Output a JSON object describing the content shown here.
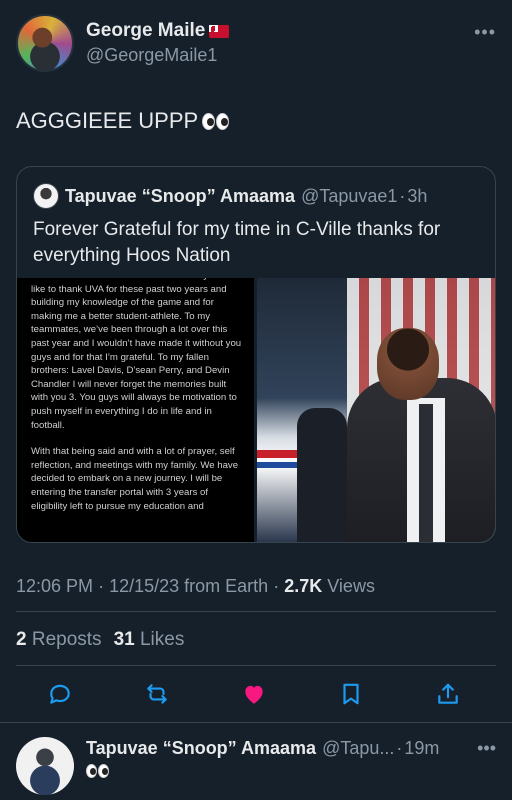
{
  "tweet": {
    "display_name": "George Maile",
    "flag_icon": "tonga-flag-icon",
    "handle": "@GeorgeMaile1",
    "more_icon": "more-horizontal-icon",
    "more_glyph": "•••",
    "text": "AGGGIEEE UPPP",
    "emoji": "eyes-emoji-icon"
  },
  "quote": {
    "display_name": "Tapuvae “Snoop” Amaama",
    "handle": "@Tapuvae1",
    "separator": "·",
    "time": "3h",
    "text": "Forever Grateful for my time in C-Ville thanks for everything Hoos Nation",
    "media_text": [
      "Without HIM I wouldn’t be who I am today. I would like to thank UVA for these past two years and building my knowledge of the game and for making me a better student-athlete. To my teammates, we’ve been through a lot over this past year and I wouldn’t have made it without you guys and for that I’m grateful. To my fallen brothers: Lavel Davis, D’sean Perry, and Devin Chandler I will never forget the memories built with you 3. You guys will always be motivation to push myself in everything I do in life and in football.",
      "With that being said and with a lot of prayer, self reflection, and meetings with my family. We have decided to embark on a new journey. I will be entering the transfer portal with 3 years of eligibility left to pursue my education and"
    ]
  },
  "meta": {
    "time": "12:06 PM",
    "dot": "·",
    "date": "12/15/23 from Earth",
    "views_count": "2.7K",
    "views_label": "Views"
  },
  "engagement": {
    "reposts_count": "2",
    "reposts_label": "Reposts",
    "likes_count": "31",
    "likes_label": "Likes"
  },
  "actions": {
    "reply_icon": "reply-icon",
    "repost_icon": "repost-icon",
    "like_icon": "heart-icon",
    "bookmark_icon": "bookmark-icon",
    "share_icon": "share-icon",
    "like_color": "#f91880",
    "icon_color": "#1d9bf0"
  },
  "reply": {
    "display_name": "Tapuvae “Snoop” Amaama",
    "handle": "@Tapu...",
    "separator": "·",
    "time": "19m",
    "more_glyph": "•••"
  },
  "colors": {
    "background": "#15202b",
    "text_primary": "#e7e9ea",
    "text_secondary": "#8b98a5",
    "border": "#38444d"
  }
}
